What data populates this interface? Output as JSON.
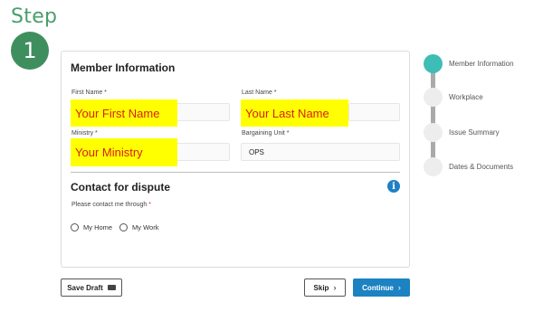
{
  "step": {
    "label": "Step",
    "number": "1"
  },
  "member_info": {
    "title": "Member Information",
    "first_name": {
      "label": "First Name *",
      "value": "Your First Name"
    },
    "last_name": {
      "label": "Last Name *",
      "value": "Your Last Name"
    },
    "ministry": {
      "label": "Ministry *",
      "value": "Your Ministry"
    },
    "bargaining_unit": {
      "label": "Bargaining Unit *",
      "value": "OPS"
    }
  },
  "contact": {
    "title": "Contact for dispute",
    "prompt": "Please contact me through ",
    "required_mark": "*",
    "options": [
      "My Home",
      "My Work"
    ]
  },
  "buttons": {
    "save_draft": "Save Draft",
    "skip": "Skip",
    "continue": "Continue"
  },
  "progress": {
    "steps": [
      "Member Information",
      "Workplace",
      "Issue Summary",
      "Dates & Documents"
    ],
    "active_index": 0
  },
  "colors": {
    "step_green": "#4a9e6a",
    "highlight_yellow": "#ffff00",
    "highlight_text_red": "#d91e18",
    "primary_blue": "#1c82c2",
    "progress_active": "#3ebdb7"
  }
}
